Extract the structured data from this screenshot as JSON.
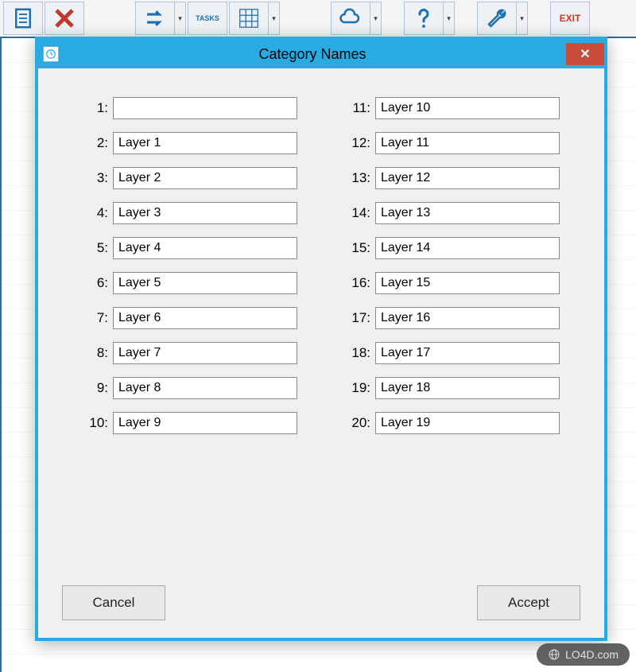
{
  "toolbar": {
    "tasks_label": "TASKS",
    "exit_label": "EXIT"
  },
  "dialog": {
    "title": "Category Names",
    "close_symbol": "✕",
    "fields": [
      {
        "num": "1:",
        "value": ""
      },
      {
        "num": "2:",
        "value": "Layer 1"
      },
      {
        "num": "3:",
        "value": "Layer 2"
      },
      {
        "num": "4:",
        "value": "Layer 3"
      },
      {
        "num": "5:",
        "value": "Layer 4"
      },
      {
        "num": "6:",
        "value": "Layer 5"
      },
      {
        "num": "7:",
        "value": "Layer 6"
      },
      {
        "num": "8:",
        "value": "Layer 7"
      },
      {
        "num": "9:",
        "value": "Layer 8"
      },
      {
        "num": "10:",
        "value": "Layer 9"
      },
      {
        "num": "11:",
        "value": "Layer 10"
      },
      {
        "num": "12:",
        "value": "Layer 11"
      },
      {
        "num": "13:",
        "value": "Layer 12"
      },
      {
        "num": "14:",
        "value": "Layer 13"
      },
      {
        "num": "15:",
        "value": "Layer 14"
      },
      {
        "num": "16:",
        "value": "Layer 15"
      },
      {
        "num": "17:",
        "value": "Layer 16"
      },
      {
        "num": "18:",
        "value": "Layer 17"
      },
      {
        "num": "19:",
        "value": "Layer 18"
      },
      {
        "num": "20:",
        "value": "Layer 19"
      }
    ],
    "cancel_label": "Cancel",
    "accept_label": "Accept"
  },
  "watermark": {
    "text": "LO4D.com"
  }
}
